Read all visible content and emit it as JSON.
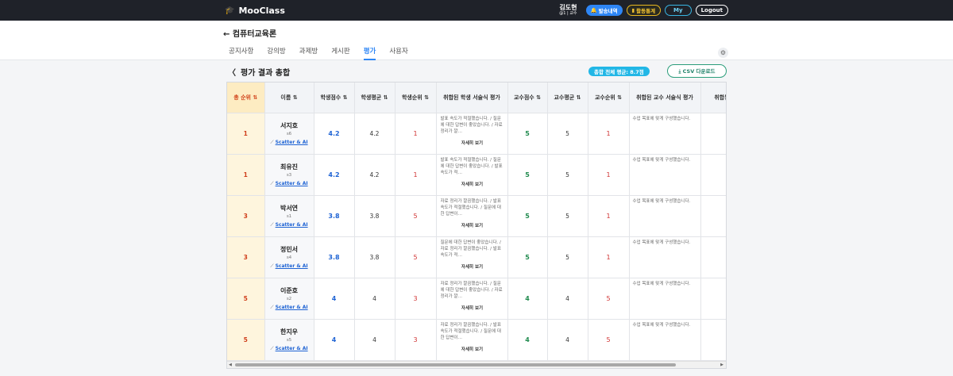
{
  "topbar": {
    "logo": "MooClass",
    "user_name": "김도현",
    "user_sub": "@1 | 교수",
    "notifications_label": "발송내역",
    "stats_label": "활동통계",
    "my_label": "My",
    "logout_label": "Logout"
  },
  "course": {
    "title": "← 컴퓨터교육론"
  },
  "tabs": [
    {
      "label": "공지사항"
    },
    {
      "label": "강의방"
    },
    {
      "label": "과제방"
    },
    {
      "label": "게시판"
    },
    {
      "label": "평가"
    },
    {
      "label": "사용자"
    }
  ],
  "section": {
    "back": "〈",
    "title": "평가 결과 총합",
    "avg_badge": "총합 전체 평균: 8.7점",
    "csv_button": "⤓ CSV 다운로드"
  },
  "table": {
    "headers": [
      "총 순위 ⇅",
      "이름 ⇅",
      "학생점수 ⇅",
      "학생평균 ⇅",
      "학생순위 ⇅",
      "취합된 학생 서술식 평가",
      "교수점수 ⇅",
      "교수평균 ⇅",
      "교수순위 ⇅",
      "취합된 교수 서술식 평가",
      "취합된"
    ],
    "scatter_label": "Scatter & AI",
    "more_label": "자세히 보기",
    "rows": [
      {
        "rank": "1",
        "name": "서지호",
        "sid": "s6",
        "s_score": "4.2",
        "s_avg": "4.2",
        "s_rank": "1",
        "s_feedback": "발표 속도가 적절했습니다. / 질문에 대한 답변이 좋았습니다. / 자료 정리가 깔…",
        "p_score": "5",
        "p_avg": "5",
        "p_rank": "1",
        "p_feedback": "수업 목표에 맞게 구성했습니다."
      },
      {
        "rank": "1",
        "name": "최유진",
        "sid": "s3",
        "s_score": "4.2",
        "s_avg": "4.2",
        "s_rank": "1",
        "s_feedback": "발표 속도가 적절했습니다. / 질문에 대한 답변이 좋았습니다. / 발표 속도가 적…",
        "p_score": "5",
        "p_avg": "5",
        "p_rank": "1",
        "p_feedback": "수업 목표에 맞게 구성했습니다."
      },
      {
        "rank": "3",
        "name": "박서연",
        "sid": "s1",
        "s_score": "3.8",
        "s_avg": "3.8",
        "s_rank": "5",
        "s_feedback": "자료 정리가 깔끔했습니다. / 발표 속도가 적절했습니다. / 질문에 대한 답변이…",
        "p_score": "5",
        "p_avg": "5",
        "p_rank": "1",
        "p_feedback": "수업 목표에 맞게 구성했습니다."
      },
      {
        "rank": "3",
        "name": "정민서",
        "sid": "s4",
        "s_score": "3.8",
        "s_avg": "3.8",
        "s_rank": "5",
        "s_feedback": "질문에 대한 답변이 좋았습니다. / 자료 정리가 깔끔했습니다. / 발표 속도가 적…",
        "p_score": "5",
        "p_avg": "5",
        "p_rank": "1",
        "p_feedback": "수업 목표에 맞게 구성했습니다."
      },
      {
        "rank": "5",
        "name": "이준호",
        "sid": "s2",
        "s_score": "4",
        "s_avg": "4",
        "s_rank": "3",
        "s_feedback": "자료 정리가 깔끔했습니다. / 질문에 대한 답변이 좋았습니다. / 자료 정리가 깔…",
        "p_score": "4",
        "p_avg": "4",
        "p_rank": "5",
        "p_feedback": "수업 목표에 맞게 구성했습니다."
      },
      {
        "rank": "5",
        "name": "한지우",
        "sid": "s5",
        "s_score": "4",
        "s_avg": "4",
        "s_rank": "3",
        "s_feedback": "자료 정리가 깔끔했습니다. / 발표 속도가 적절했습니다. / 질문에 대한 답변이…",
        "p_score": "4",
        "p_avg": "4",
        "p_rank": "5",
        "p_feedback": "수업 목표에 맞게 구성했습니다."
      }
    ]
  },
  "scrollbar": {
    "left_arrow": "◀",
    "right_arrow": "▶"
  },
  "icons": {
    "logo": "graduation-cap-icon",
    "bell": "bell-icon",
    "chart": "bar-chart-icon",
    "gear": "gear-icon",
    "scatter": "scatter-plot-icon",
    "download": "download-icon"
  },
  "colors": {
    "topbar": "#1f2229",
    "accent_blue": "#2e86f5",
    "rank_header_bg": "#fdecc2",
    "rank_text": "#cf3d1a",
    "green": "#1f8a4d",
    "red": "#d03333"
  }
}
